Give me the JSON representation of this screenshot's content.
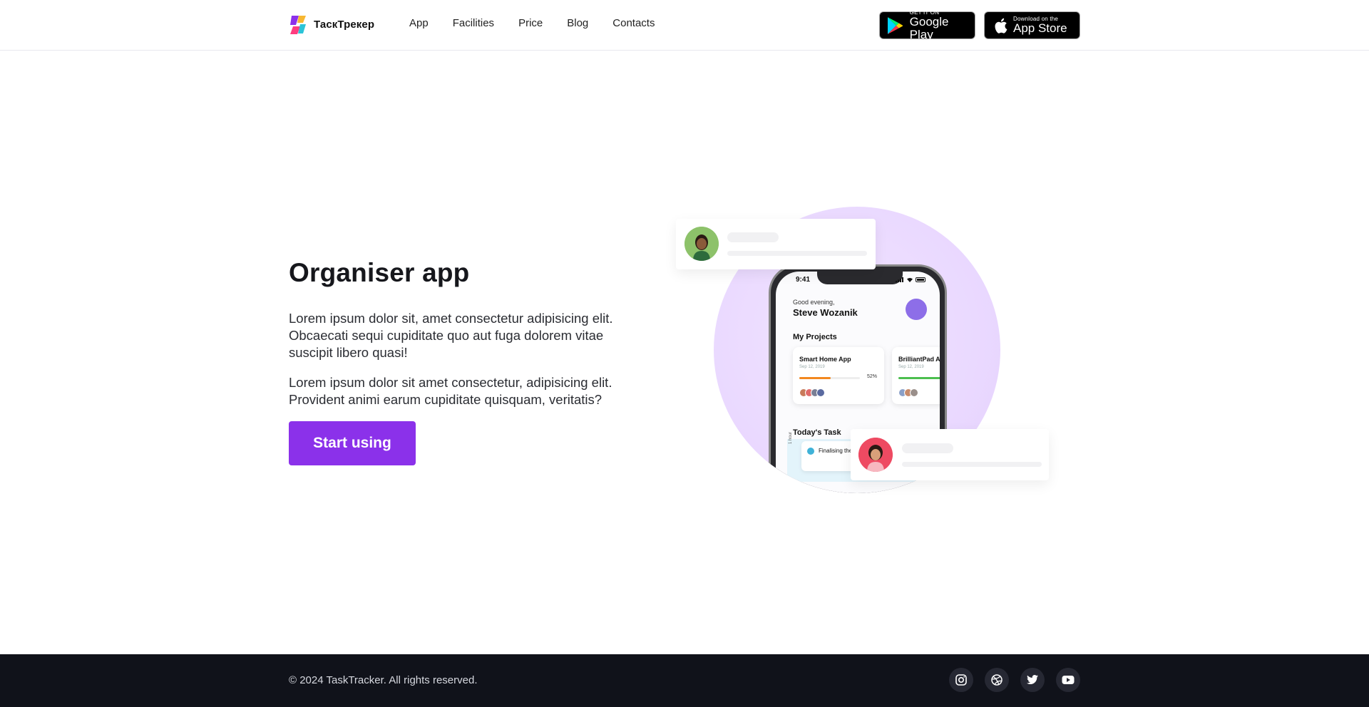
{
  "header": {
    "logo_text": "ТаскТрекер",
    "nav": [
      "App",
      "Facilities",
      "Price",
      "Blog",
      "Contacts"
    ],
    "google_play": {
      "small": "GET IT ON",
      "big": "Google Play"
    },
    "app_store": {
      "small": "Download on the",
      "big": "App Store"
    }
  },
  "hero": {
    "title": "Organiser app",
    "paragraph1": "Lorem ipsum dolor sit, amet consectetur adipisicing elit. Obcaecati sequi cupiditate quo aut fuga dolorem vitae suscipit libero quasi!",
    "paragraph2": "Lorem ipsum dolor sit amet consectetur, adipisicing elit. Provident animi earum cupiditate quisquam, veritatis?",
    "cta_label": "Start using"
  },
  "phone": {
    "time": "9:41",
    "greeting": "Good evening,",
    "user_name": "Steve Wozanik",
    "projects_heading": "My Projects",
    "projects": [
      {
        "name": "Smart Home App",
        "date": "Sep 12, 2019",
        "progress_label": "52%",
        "progress": 0.52,
        "color": "#f2881f"
      },
      {
        "name": "BrilliantPad A",
        "date": "Sep 12, 2019",
        "progress": 0.8,
        "color": "#4cbf4f"
      }
    ],
    "today_heading": "Today's Task",
    "task_text": "Finalising the for developm",
    "hour_label": "1 hour"
  },
  "footer": {
    "copyright": "© 2024 TaskTracker. All rights reserved.",
    "socials": [
      "instagram-icon",
      "dribbble-icon",
      "twitter-icon",
      "youtube-icon"
    ]
  },
  "colors": {
    "accent": "#8b31ea",
    "footer_bg": "#10121a",
    "circle": "#ead9ff"
  }
}
